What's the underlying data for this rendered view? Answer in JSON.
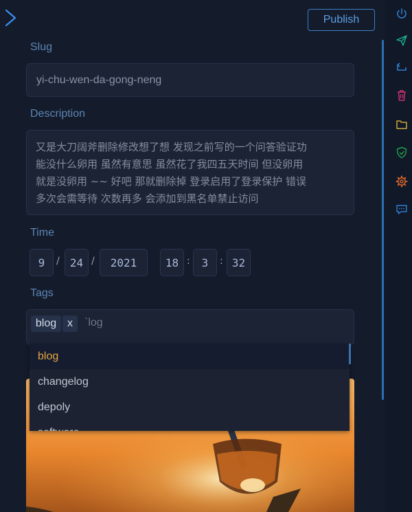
{
  "header": {
    "publish_label": "Publish"
  },
  "slug": {
    "label": "Slug",
    "value": "yi-chu-wen-da-gong-neng"
  },
  "description": {
    "label": "Description",
    "lines": [
      "又是大刀阔斧删除修改想了想  发现之前写的一个问答验证功",
      "能没什么卵用  虽然有意思  虽然花了我四五天时间  但没卵用",
      "就是没卵用  ~~  好吧  那就删除掉  登录启用了登录保护  错误",
      "多次会需等待  次数再多  会添加到黑名单禁止访问"
    ]
  },
  "time": {
    "label": "Time",
    "month": "9",
    "day": "24",
    "year": "2021",
    "hour": "18",
    "minute": "3",
    "second": "32",
    "date_sep": "/",
    "time_sep": ":"
  },
  "tags": {
    "label": "Tags",
    "chips": [
      {
        "label": "blog",
        "remove": "x"
      }
    ],
    "input_value": "`log"
  },
  "dropdown": {
    "options": [
      "blog",
      "changelog",
      "depoly",
      "software"
    ],
    "active": "blog"
  },
  "rail": {
    "icons": [
      "power-icon",
      "send-icon",
      "return-icon",
      "trash-icon",
      "folder-icon",
      "shield-check-icon",
      "settings-icon",
      "comment-icon"
    ],
    "colors": {
      "blue": "#2f7fd0",
      "teal": "#1fae8c",
      "pink": "#c8336f",
      "yellow": "#c9a83b",
      "green": "#1f9d4a",
      "orange": "#d4642a"
    }
  },
  "colors": {
    "accent": "#3d80c6",
    "active_option": "#e6a642",
    "background": "#141b2b"
  }
}
